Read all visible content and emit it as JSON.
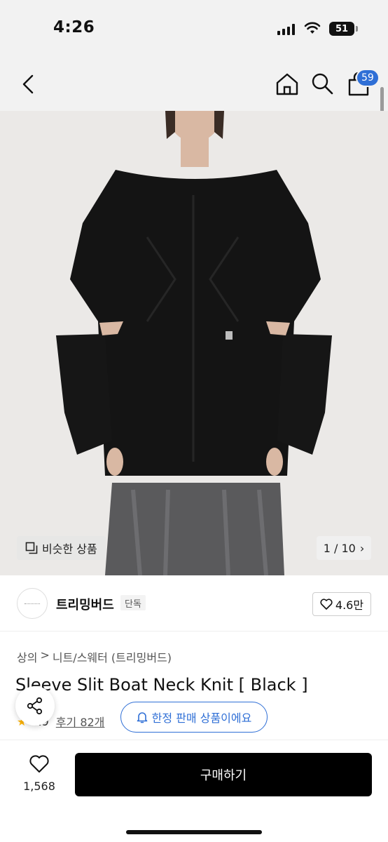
{
  "status_bar": {
    "time": "4:26",
    "battery": "51"
  },
  "nav": {
    "back_icon": "chevron-left-icon",
    "home_icon": "home-icon",
    "search_icon": "search-icon",
    "cart_icon": "cart-icon",
    "cart_count": "59"
  },
  "hero": {
    "similar_label": "비슷한 상품",
    "pager": "1 / 10",
    "pager_arrow": "›"
  },
  "brand": {
    "name": "트리밍버드",
    "badge": "단독",
    "likes": "4.6만"
  },
  "breadcrumb": {
    "category": "상의",
    "separator": ">",
    "subcategory": "니트/스웨터 (트리밍버드)"
  },
  "product": {
    "title": "Sleeve Slit Boat Neck Knit [ Black ]",
    "rating": "4.9",
    "reviews": "후기 82개",
    "limited_label": "한정 판매 상품이에요"
  },
  "bottom_bar": {
    "wish_count": "1,568",
    "buy_label": "구매하기"
  },
  "colors": {
    "accent": "#2f6fd6",
    "buy_button": "#000000",
    "star": "#ffb400"
  }
}
